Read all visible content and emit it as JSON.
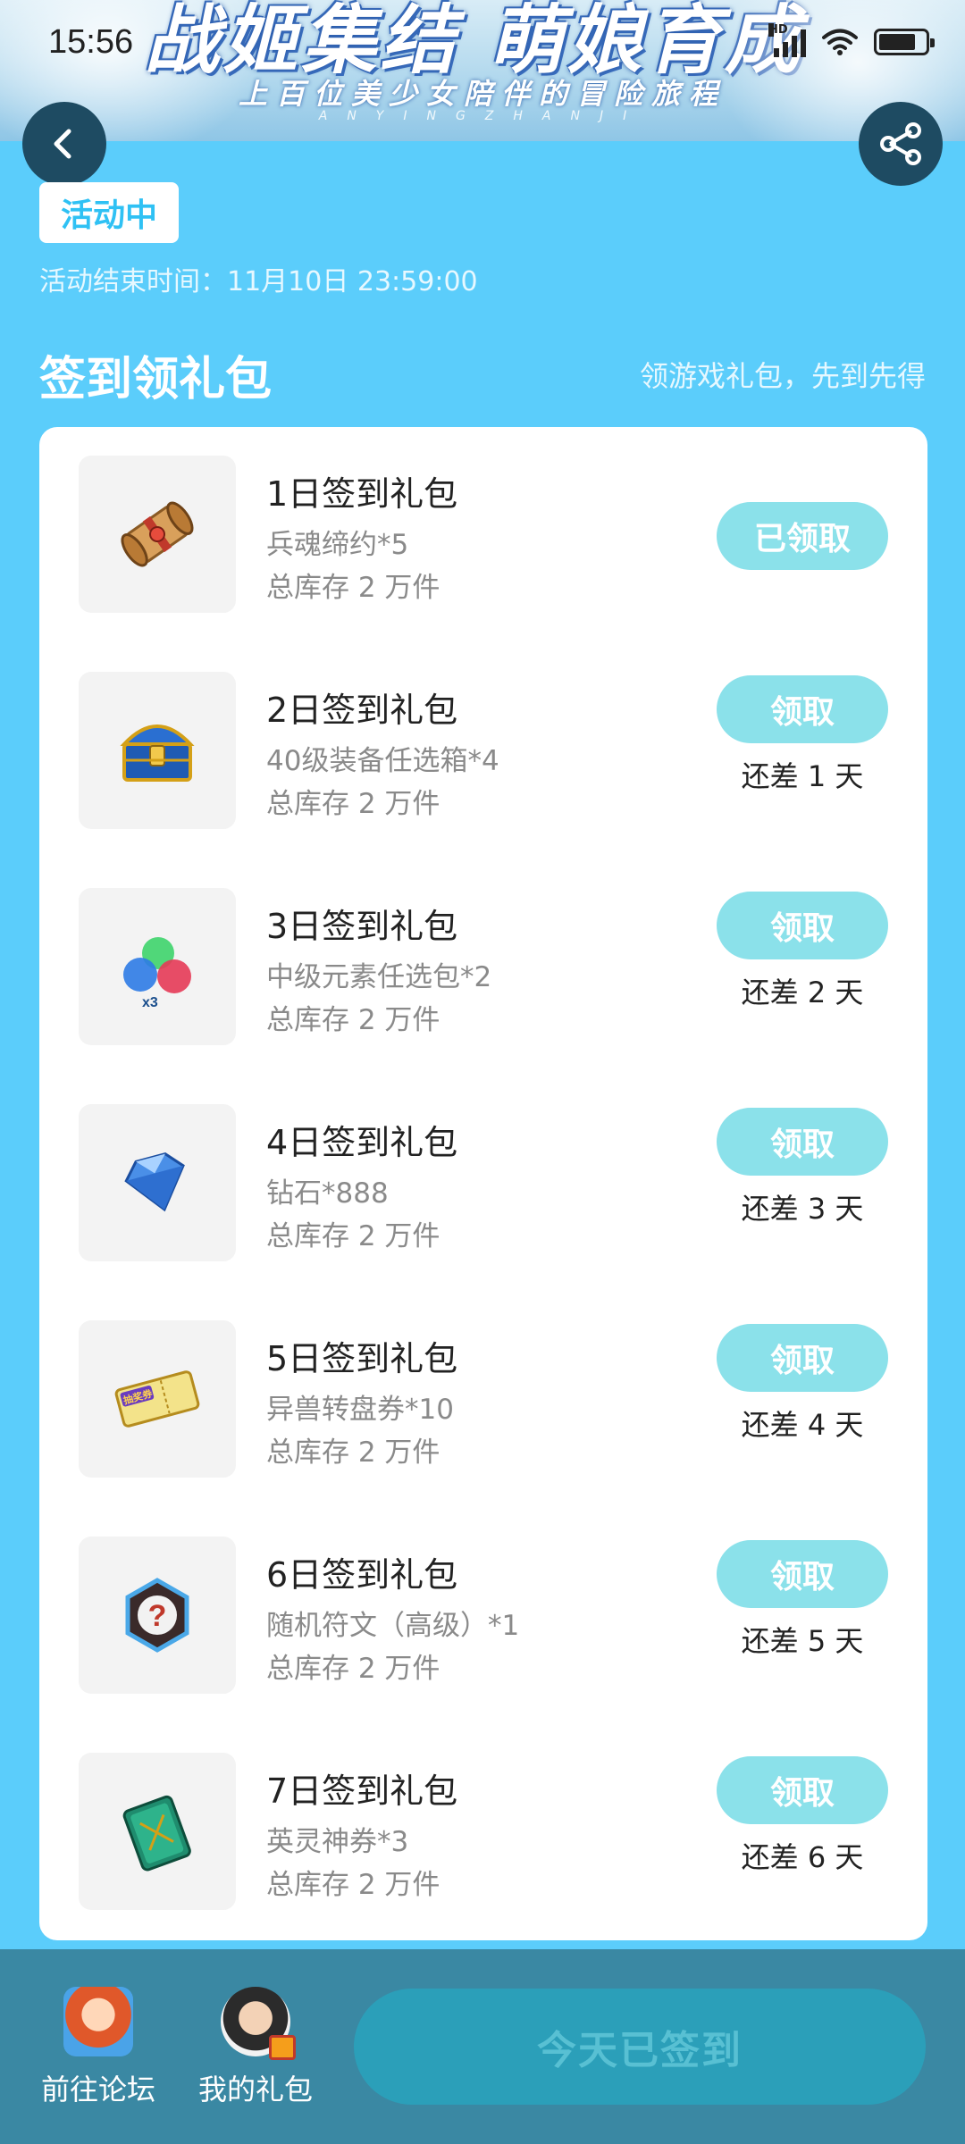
{
  "status_bar": {
    "time": "15:56",
    "network_badge": "HD"
  },
  "banner": {
    "title": "战姬集结 萌娘育成",
    "subtitle": "上百位美少女陪伴的冒险旅程",
    "pinyin": "ANYINGZHANJI"
  },
  "event": {
    "status_chip": "活动中",
    "end_time": "活动结束时间：11月10日 23:59:00"
  },
  "section": {
    "title": "签到领礼包",
    "subtitle": "领游戏礼包，先到先得"
  },
  "gifts": [
    {
      "title": "1日签到礼包",
      "desc": "兵魂缔约*5",
      "stock": "总库存 2 万件",
      "button": "已领取",
      "days_left": "",
      "icon": "scroll-icon"
    },
    {
      "title": "2日签到礼包",
      "desc": "40级装备任选箱*4",
      "stock": "总库存 2 万件",
      "button": "领取",
      "days_left": "还差 1 天",
      "icon": "treasure-chest-icon"
    },
    {
      "title": "3日签到礼包",
      "desc": "中级元素任选包*2",
      "stock": "总库存 2 万件",
      "button": "领取",
      "days_left": "还差 2 天",
      "icon": "element-orbs-icon",
      "icon_badge": "x3"
    },
    {
      "title": "4日签到礼包",
      "desc": "钻石*888",
      "stock": "总库存 2 万件",
      "button": "领取",
      "days_left": "还差 3 天",
      "icon": "diamond-icon"
    },
    {
      "title": "5日签到礼包",
      "desc": "异兽转盘券*10",
      "stock": "总库存 2 万件",
      "button": "领取",
      "days_left": "还差 4 天",
      "icon": "ticket-icon",
      "icon_badge": "抽奖券"
    },
    {
      "title": "6日签到礼包",
      "desc": "随机符文（高级）*1",
      "stock": "总库存 2 万件",
      "button": "领取",
      "days_left": "还差 5 天",
      "icon": "mystery-rune-icon",
      "icon_badge": "?"
    },
    {
      "title": "7日签到礼包",
      "desc": "英灵神券*3",
      "stock": "总库存 2 万件",
      "button": "领取",
      "days_left": "还差 6 天",
      "icon": "spirit-voucher-icon"
    }
  ],
  "bottom_bar": {
    "forum_label": "前往论坛",
    "my_gifts_label": "我的礼包",
    "signin_button": "今天已签到"
  },
  "colors": {
    "page_bg": "#5bcdfb",
    "button_teal": "#8be1ea",
    "bottom_bar": "#3a88a3",
    "signin_disabled": "#2b9fb9"
  }
}
